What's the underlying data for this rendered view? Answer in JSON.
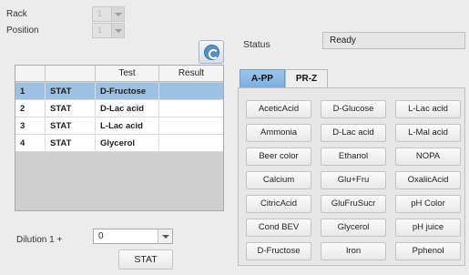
{
  "form": {
    "rack_label": "Rack",
    "rack_value": "1",
    "position_label": "Position",
    "position_value": "1"
  },
  "table": {
    "headers": [
      "",
      "",
      "Test",
      "Result"
    ],
    "rows": [
      {
        "num": "1",
        "type": "STAT",
        "test": "D-Fructose",
        "result": "",
        "selected": true
      },
      {
        "num": "2",
        "type": "STAT",
        "test": "D-Lac acid",
        "result": "",
        "selected": false
      },
      {
        "num": "3",
        "type": "STAT",
        "test": "L-Lac acid",
        "result": "",
        "selected": false
      },
      {
        "num": "4",
        "type": "STAT",
        "test": "Glycerol",
        "result": "",
        "selected": false
      }
    ]
  },
  "dilution": {
    "label": "Dilution 1 +",
    "value": "0"
  },
  "stat_button": "STAT",
  "status": {
    "label": "Status",
    "value": "Ready"
  },
  "tabs": [
    {
      "label": "A-PP",
      "active": true
    },
    {
      "label": "PR-Z",
      "active": false
    }
  ],
  "tests": [
    "AceticAcid",
    "D-Glucose",
    "L-Lac acid",
    "Ammonia",
    "D-Lac acid",
    "L-Mal acid",
    "Beer color",
    "Ethanol",
    "NOPA",
    "Calcium",
    "Glu+Fru",
    "OxalicAcid",
    "CitricAcid",
    "GluFruSucr",
    "pH Color",
    "Cond BEV",
    "Glycerol",
    "pH juice",
    "D-Fructose",
    "Iron",
    "Pphenol"
  ],
  "icons": {
    "refresh": "refresh-icon"
  }
}
